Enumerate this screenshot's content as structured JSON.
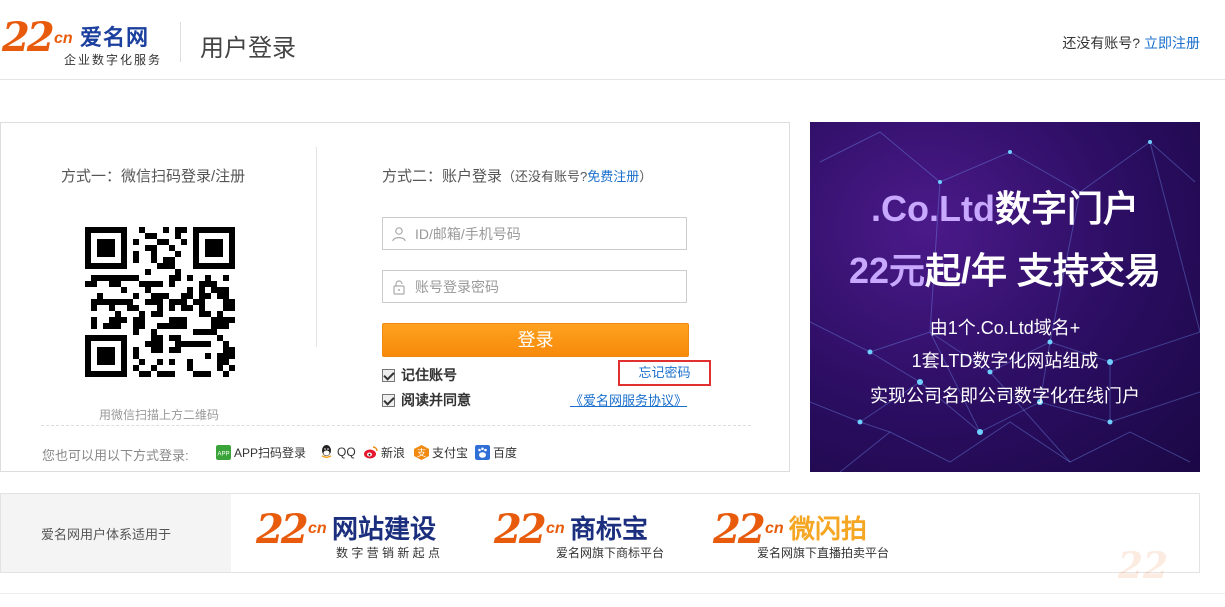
{
  "header": {
    "logo_number": "22",
    "logo_cn": "cn",
    "logo_name": "爱名网",
    "logo_tagline": "企业数字化服务",
    "page_title": "用户登录",
    "no_account_text": "还没有账号?",
    "register_link": "立即注册"
  },
  "method1": {
    "title": "方式一：微信扫码登录/注册",
    "qr_tip": "用微信扫描上方二维码"
  },
  "method2": {
    "title": "方式二：账户登录",
    "hint_prefix": "（还没有账号?",
    "hint_link": "免费注册",
    "hint_suffix": "）",
    "username_placeholder": "ID/邮箱/手机号码",
    "password_placeholder": "账号登录密码",
    "login_button": "登录",
    "remember_label": "记住账号",
    "forgot_label": "忘记密码",
    "agree_label": "阅读并同意",
    "agreement_link": "《爱名网服务协议》"
  },
  "other_login": {
    "label": "您也可以用以下方式登录:",
    "items": [
      {
        "label": "APP扫码登录",
        "icon": "app-icon",
        "color": "#3aa33a"
      },
      {
        "label": "QQ",
        "icon": "qq-icon",
        "color": "#222222"
      },
      {
        "label": "新浪",
        "icon": "weibo-icon",
        "color": "#e6162d"
      },
      {
        "label": "支付宝",
        "icon": "alipay-icon",
        "color": "#f08a10"
      },
      {
        "label": "百度",
        "icon": "baidu-icon",
        "color": "#2f6fd6"
      }
    ]
  },
  "banner": {
    "line1_highlight": ".Co.Ltd",
    "line1_rest": "数字门户",
    "line2_highlight": "22元",
    "line2_rest": "起/年  支持交易",
    "line3": "由1个.Co.Ltd域名+",
    "line4": "1套LTD数字化网站组成",
    "line5": "实现公司名即公司数字化在线门户"
  },
  "footer": {
    "left_text": "爱名网用户体系适用于",
    "brands": [
      {
        "name": "网站建设",
        "sub": "数 字 营 销 新 起 点"
      },
      {
        "name": "商标宝",
        "sub": "爱名网旗下商标平台"
      },
      {
        "name": "微闪拍",
        "sub": "爱名网旗下直播拍卖平台"
      }
    ]
  },
  "colors": {
    "brand_orange": "#e85b0c",
    "brand_blue": "#1b3f9e",
    "link_blue": "#1a6fcc",
    "button_orange": "#f7890b",
    "forgot_border": "#e03030"
  }
}
